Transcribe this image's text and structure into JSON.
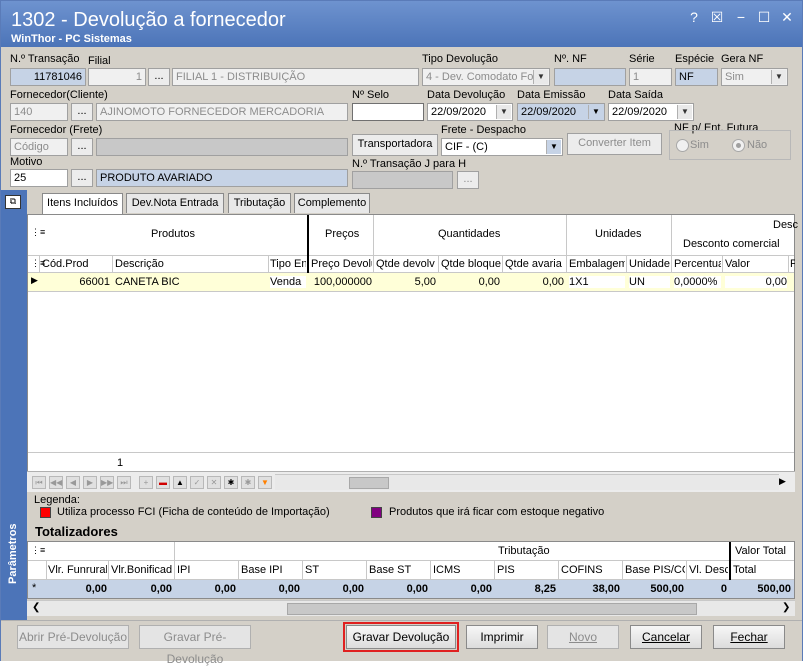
{
  "window": {
    "title": "1302 - Devolução a fornecedor",
    "subtitle": "WinThor - PC Sistemas",
    "controls": [
      "?",
      "☒",
      "−",
      "☐",
      "✕"
    ]
  },
  "form": {
    "transacao": {
      "label": "N.º Transação",
      "value": "11781046"
    },
    "filial": {
      "label": "Filial",
      "code": "1",
      "name": "FILIAL 1 - DISTRIBUIÇÃO"
    },
    "tipo_devolucao": {
      "label": "Tipo Devolução",
      "value": "4 - Dev. Comodato Fo"
    },
    "num_nf": {
      "label": "Nº. NF",
      "value": ""
    },
    "serie": {
      "label": "Série",
      "value": "1"
    },
    "especie": {
      "label": "Espécie",
      "value": "NF"
    },
    "gera_nf": {
      "label": "Gera NF",
      "value": "Sim"
    },
    "fornecedor_cliente": {
      "label": "Fornecedor(Cliente)",
      "code": "140",
      "name": "AJINOMOTO FORNECEDOR MERCADORIA"
    },
    "num_selo": {
      "label": "Nº Selo",
      "value": ""
    },
    "data_devolucao": {
      "label": "Data Devolução",
      "value": "22/09/2020"
    },
    "data_emissao": {
      "label": "Data Emissão",
      "value": "22/09/2020"
    },
    "data_saida": {
      "label": "Data Saída",
      "value": "22/09/2020"
    },
    "fornecedor_frete": {
      "label": "Fornecedor (Frete)",
      "placeholder": "Código"
    },
    "transportadora_label": "Transportadora",
    "frete_despacho": {
      "label": "Frete - Despacho",
      "value": "CIF - (C)"
    },
    "converter_item": "Converter Item",
    "nf_futura": {
      "label": "NF p/ Ent. Futura",
      "sim": "Sim",
      "nao": "Não"
    },
    "motivo": {
      "label": "Motivo",
      "code": "25",
      "desc": "PRODUTO AVARIADO"
    },
    "transacao_j": {
      "label": "N.º Transação J para H",
      "value": ""
    },
    "ellipsis": "..."
  },
  "tabs": [
    "Itens Incluídos",
    "Dev.Nota Entrada",
    "Tributação",
    "Complemento"
  ],
  "grid": {
    "group_headers": [
      "Produtos",
      "Preços",
      "Quantidades",
      "Unidades",
      "Desc",
      "Desconto comercial"
    ],
    "columns": [
      "Cód.Prod",
      "Descrição",
      "Tipo En",
      "Preço Devolu",
      "Qtde devolv",
      "Qtde bloque",
      "Qtde avaria",
      "Embalagem",
      "Unidade",
      "Percentua",
      "Valor",
      "P"
    ],
    "rows": [
      [
        "66001",
        "CANETA BIC",
        "Venda",
        "100,000000",
        "5,00",
        "0,00",
        "0,00",
        "1X1",
        "UN",
        "0,0000%",
        "0,00",
        ""
      ]
    ],
    "count": "1"
  },
  "legend": {
    "title": "Legenda:",
    "items": [
      {
        "color": "#ff0000",
        "text": "Utiliza processo FCI (Ficha de conteúdo de Importação)"
      },
      {
        "color": "#800080",
        "text": "Produtos que irá ficar com estoque negativo"
      }
    ]
  },
  "totalizadores": {
    "title": "Totalizadores",
    "group_headers": [
      "Tributação",
      "Valor Total"
    ],
    "columns": [
      "Vlr. Funrural",
      "Vlr.Bonificad",
      "IPI",
      "Base IPI",
      "ST",
      "Base ST",
      "ICMS",
      "PIS",
      "COFINS",
      "Base PIS/CO",
      "Vl. Desc",
      "Total"
    ],
    "values": [
      "0,00",
      "0,00",
      "0,00",
      "0,00",
      "0,00",
      "0,00",
      "0,00",
      "8,25",
      "38,00",
      "500,00",
      "0",
      "500,00"
    ]
  },
  "sidebar_label": "Parâmetros",
  "buttons": {
    "abrir": "Abrir Pré-Devolução",
    "gravar_pre": "Gravar Pré-Devolução",
    "gravar": "Gravar Devolução",
    "imprimir": "Imprimir",
    "novo": "Novo",
    "cancelar": "Cancelar",
    "fechar": "Fechar"
  },
  "colors": {
    "title_bar": "#4c74b8",
    "highlight": "#e02020",
    "row_highlight": "#ffffd8"
  }
}
